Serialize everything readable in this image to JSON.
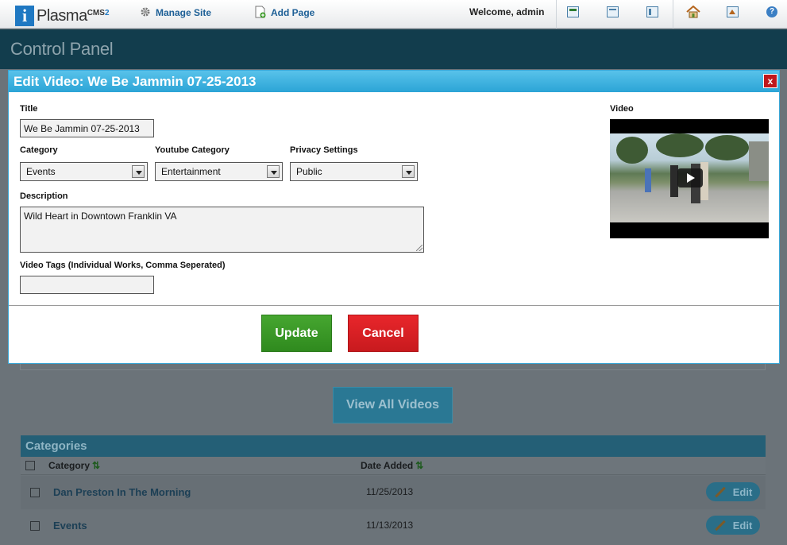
{
  "topbar": {
    "brand": "Plasma",
    "brand_sup": "CMS",
    "brand_ver": "2",
    "manage_site": "Manage Site",
    "add_page": "Add Page",
    "welcome": "Welcome, admin",
    "help": "?"
  },
  "page": {
    "title": "Control Panel"
  },
  "modal": {
    "title": "Edit Video: We Be Jammin 07-25-2013",
    "close": "x",
    "title_label": "Title",
    "title_value": "We Be Jammin 07-25-2013",
    "category_label": "Category",
    "category_value": "Events",
    "youtube_category_label": "Youtube Category",
    "youtube_category_value": "Entertainment",
    "privacy_label": "Privacy Settings",
    "privacy_value": "Public",
    "description_label": "Description",
    "description_value": "Wild Heart in Downtown Franklin VA",
    "tags_label": "Video Tags (Individual Works, Comma Seperated)",
    "tags_value": "",
    "video_label": "Video",
    "update": "Update",
    "cancel": "Cancel"
  },
  "background": {
    "view_all": "View All Videos",
    "categories_title": "Categories",
    "col_category": "Category",
    "col_date": "Date Added",
    "sort_glyph": "⇅",
    "rows": [
      {
        "name": "Dan Preston In The Morning",
        "date": "11/25/2013",
        "edit": "Edit"
      },
      {
        "name": "Events",
        "date": "11/13/2013",
        "edit": "Edit"
      }
    ]
  },
  "colors": {
    "accent": "#2ba4d6",
    "update": "#3a9a26",
    "cancel": "#d61f24",
    "header_band": "#123d4d"
  }
}
